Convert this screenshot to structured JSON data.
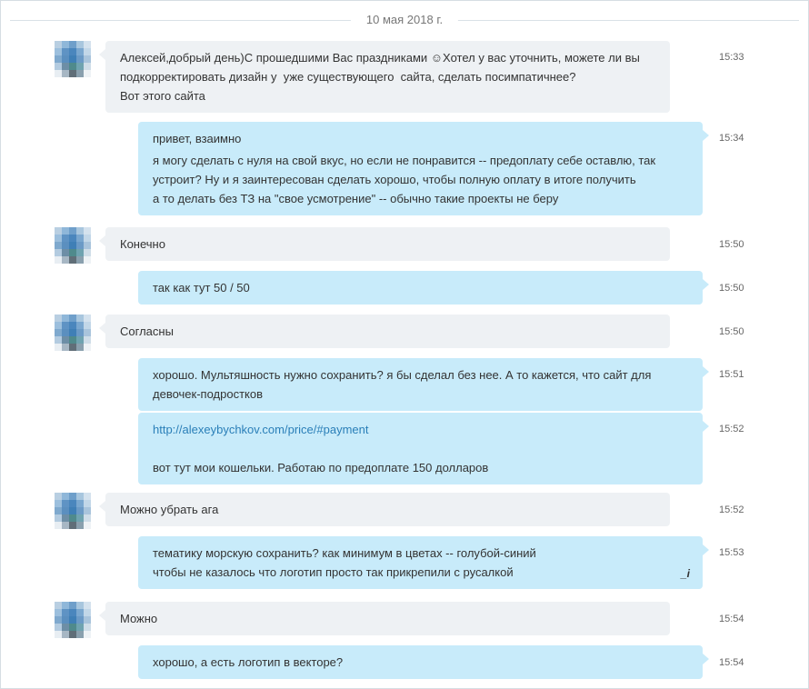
{
  "date_divider": "10 мая 2018 г.",
  "messages": [
    {
      "dir": "in",
      "time": "15:33",
      "lines": [
        "Алексей,добрый день)С прошедшими Вас праздниками ☺Хотел у вас уточнить, можете ли вы",
        "подкорректировать дизайн у  уже существующего  сайта, сделать посимпатичнее?",
        "Вот этого сайта"
      ]
    },
    {
      "dir": "out",
      "time": "15:34",
      "lines": [
        "привет, взаимно",
        "я могу сделать с нуля на свой вкус, но если не понравится -- предоплату себе оставлю, так",
        "устроит? Ну и я заинтересован сделать хорошо, чтобы полную оплату в итоге получить",
        "а то делать без ТЗ на \"свое усмотрение\" -- обычно такие проекты не беру"
      ]
    },
    {
      "dir": "in",
      "time": "15:50",
      "lines": [
        "Конечно"
      ]
    },
    {
      "dir": "out",
      "time": "15:50",
      "lines": [
        "так как тут 50 / 50"
      ]
    },
    {
      "dir": "in",
      "time": "15:50",
      "lines": [
        "Согласны"
      ]
    },
    {
      "dir": "out",
      "time": "15:51",
      "lines": [
        "хорошо. Мультяшность нужно сохранить? я бы сделал без нее. А то кажется, что сайт для",
        "девочек-подростков"
      ]
    },
    {
      "dir": "out",
      "time": "15:52",
      "link": "http://alexeybychkov.com/price/#payment",
      "lines": [
        "вот тут мои кошельки. Работаю по предоплате 150 долларов"
      ]
    },
    {
      "dir": "in",
      "time": "15:52",
      "lines": [
        "Можно убрать ага"
      ]
    },
    {
      "dir": "out",
      "time": "15:53",
      "edited": "_i",
      "lines": [
        "тематику морскую сохранить? как минимум в цветах -- голубой-синий",
        "чтобы не казалось что логотип просто так прикрепили с русалкой"
      ]
    },
    {
      "dir": "in",
      "time": "15:54",
      "lines": [
        "Можно"
      ]
    },
    {
      "dir": "out",
      "time": "15:54",
      "lines": [
        "хорошо, а есть логотип в векторе?"
      ]
    }
  ]
}
